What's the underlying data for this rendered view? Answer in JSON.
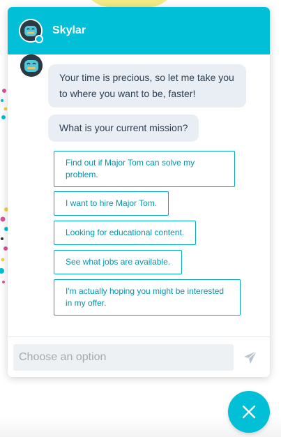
{
  "header": {
    "bot_name": "Skylar",
    "avatar_icon": "robot-avatar-icon",
    "status": "online"
  },
  "messages": [
    {
      "sender": "Skylar",
      "text": "Your time is precious, so let me take you to where you want to be, faster!"
    },
    {
      "sender": "Skylar",
      "text": "What is your current mission?"
    }
  ],
  "options": [
    {
      "label": "Find out if Major Tom can solve my problem."
    },
    {
      "label": "I want to hire Major Tom."
    },
    {
      "label": "Looking for educational content."
    },
    {
      "label": "See what jobs are available."
    },
    {
      "label": "I'm actually hoping you might be interested in my offer."
    }
  ],
  "composer": {
    "placeholder": "Choose an option",
    "value": "",
    "send_icon": "paper-plane-icon"
  },
  "launcher": {
    "icon": "close-icon"
  },
  "colors": {
    "accent": "#00bfd6",
    "option_border": "#00aac1",
    "option_text": "#0096ad",
    "bubble_bg": "#e9eef4",
    "bubble_text": "#2c3e50"
  }
}
